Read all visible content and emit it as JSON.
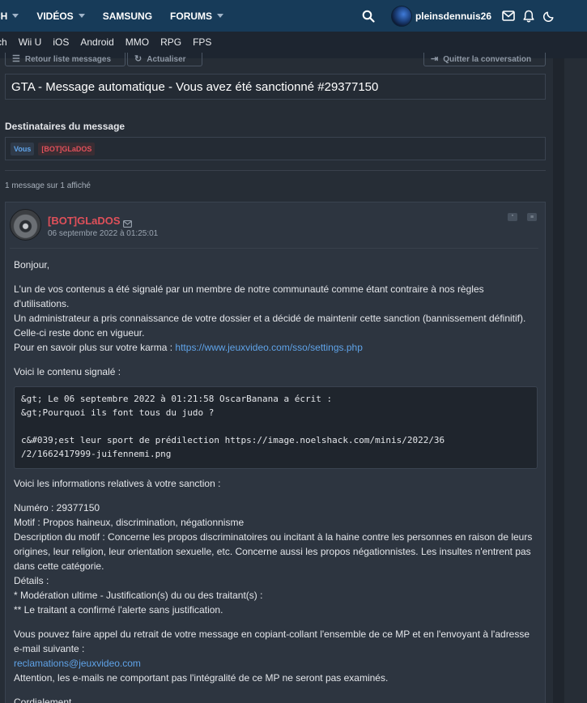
{
  "nav": {
    "items": [
      {
        "label": "CH",
        "caret": true
      },
      {
        "label": "VIDÉOS",
        "caret": true
      },
      {
        "label": "SAMSUNG",
        "caret": false
      },
      {
        "label": "FORUMS",
        "caret": true
      }
    ],
    "username": "pleinsdennuis26"
  },
  "subnav": [
    "ch",
    "Wii U",
    "iOS",
    "Android",
    "MMO",
    "RPG",
    "FPS"
  ],
  "actions": {
    "back": "Retour liste messages",
    "refresh": "Actualiser",
    "leave": "Quitter la conversation"
  },
  "conversation": {
    "title": "GTA - Message automatique - Vous avez été sanctionné #29377150",
    "recipients_label": "Destinataires du message",
    "recipients": [
      "Vous",
      "[BOT]GLaDOS"
    ],
    "count_text": "1 message sur 1 affiché"
  },
  "message": {
    "author": "[BOT]GLaDOS",
    "date": "06 septembre 2022 à 01:25:01",
    "greeting": "Bonjour,",
    "p1": "L'un de vos contenus a été signalé par un membre de notre communauté comme étant contraire à nos règles d'utilisations.",
    "p2": "Un administrateur a pris connaissance de votre dossier et a décidé de maintenir cette sanction (bannissement définitif).",
    "p3": "Celle-ci reste donc en vigueur.",
    "karma_prefix": "Pour en savoir plus sur votre karma : ",
    "karma_link": "https://www.jeuxvideo.com/sso/settings.php",
    "reported_label": "Voici le contenu signalé :",
    "quote_line1": "&gt; Le 06 septembre 2022 à 01:21:58 OscarBanana a écrit :",
    "quote_line2": "&gt;Pourquoi ils font tous du judo ?",
    "quote_line3": "c&#039;est leur sport de prédilection https://image.noelshack.com/minis/2022/36",
    "quote_line4": "/2/1662417999-juifennemi.png",
    "info_label": "Voici les informations relatives à votre sanction :",
    "number": "Numéro : 29377150",
    "motif": "Motif : Propos haineux, discrimination, négationnisme",
    "description": "Description du motif : Concerne les propos discriminatoires ou incitant à la haine contre les personnes en raison de leurs origines, leur religion, leur orientation sexuelle, etc. Concerne aussi les propos négationnistes. Les insultes n'entrent pas dans cette catégorie.",
    "details": "Détails :",
    "detail1": "* Modération ultime - Justification(s) du ou des traitant(s) :",
    "detail2": "** Le traitant a confirmé l'alerte sans justification.",
    "appeal": "Vous pouvez faire appel du retrait de votre message en copiant-collant l'ensemble de ce MP et en l'envoyant à l'adresse e-mail suivante :",
    "appeal_email": "reclamations@jeuxvideo.com",
    "warning": "Attention, les e-mails ne comportant pas l'intégralité de ce MP ne seront pas examinés.",
    "closing": "Cordialement,"
  },
  "colors": {
    "nav_bg": "#173b59",
    "accent_link": "#5fa3e8",
    "bot_red": "#e0505a"
  }
}
